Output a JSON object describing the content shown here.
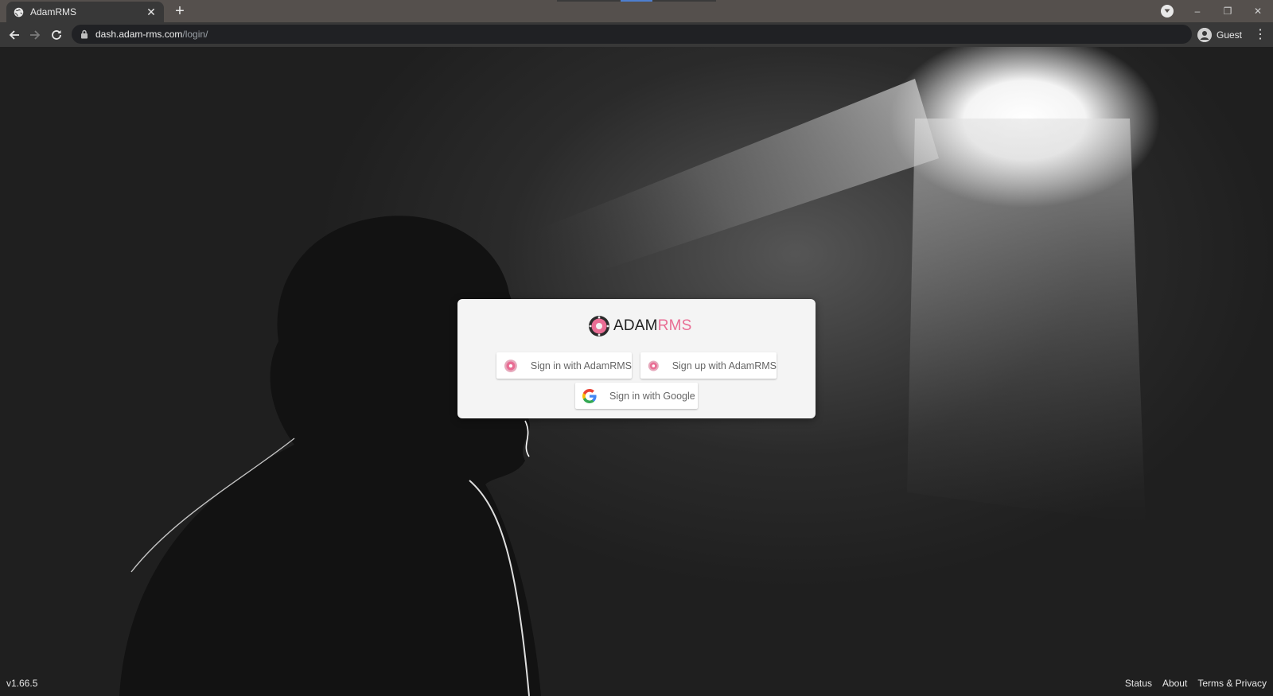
{
  "browser": {
    "tab_title": "AdamRMS",
    "url_host": "dash.adam-rms.com",
    "url_path": "/login/",
    "profile_label": "Guest",
    "window_controls": {
      "minimize": "–",
      "restore": "❐",
      "close": "✕"
    }
  },
  "login": {
    "logo": {
      "part1": "ADAM",
      "part2": "RMS"
    },
    "buttons": {
      "signin_adamrms": "Sign in with AdamRMS",
      "signup_adamrms": "Sign up with AdamRMS",
      "signin_google": "Sign in with Google"
    }
  },
  "footer": {
    "version": "v1.66.5",
    "links": [
      "Status",
      "About",
      "Terms & Privacy"
    ]
  },
  "colors": {
    "brand_pink": "#e96d94",
    "card_bg": "#f4f4f4",
    "chrome_dark": "#383838"
  },
  "icons": {
    "favicon": "globe-icon",
    "back": "arrow-left-icon",
    "forward": "arrow-right-icon",
    "reload": "reload-icon",
    "lock": "lock-icon",
    "profile": "person-icon",
    "menu": "kebab-menu-icon",
    "google": "google-g-icon",
    "adamrms": "adamrms-logo-icon"
  }
}
